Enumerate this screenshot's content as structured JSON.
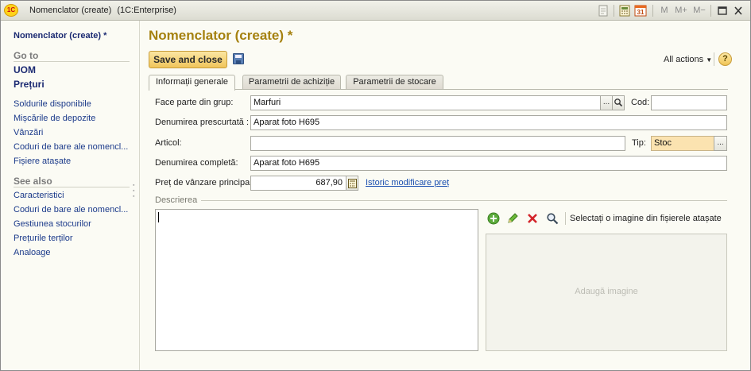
{
  "window": {
    "title": "Nomenclator (create)",
    "app_name": "(1C:Enterprise)",
    "logo_text": "1С",
    "calendar_day": "31",
    "memory_buttons": [
      "M",
      "M+",
      "M−"
    ]
  },
  "left_panel": {
    "title": "Nomenclator (create) *",
    "goto_section": "Go to",
    "goto_bold_links": [
      "UOM",
      "Prețuri"
    ],
    "goto_links": [
      "Soldurile disponibile",
      "Mișcările de depozite",
      "Vânzări",
      "Coduri de bare ale nomencl...",
      "Fișiere atașate"
    ],
    "see_also_section": "See also",
    "see_also_links": [
      "Caracteristici",
      "Coduri de bare ale nomencl...",
      "Gestiunea stocurilor",
      "Prețurile terților",
      "Analoage"
    ]
  },
  "form": {
    "title": "Nomenclator (create) *",
    "save_close": "Save and close",
    "all_actions": "All actions",
    "help": "?",
    "tabs": [
      "Informații generale",
      "Parametrii de achiziție",
      "Parametrii de stocare"
    ],
    "fields": {
      "group_label": "Face parte din grup:",
      "group_value": "Marfuri",
      "cod_label": "Cod:",
      "cod_value": "",
      "short_name_label": "Denumirea prescurtată :",
      "short_name_value": "Aparat foto H695",
      "article_label": "Articol:",
      "article_value": "",
      "type_label": "Tip:",
      "type_value": "Stoc",
      "full_name_label": "Denumirea completă:",
      "full_name_value": "Aparat foto H695",
      "price_label": "Preț de vânzare principal:",
      "price_value": "687,90",
      "price_history_link": "Istoric modificare preț"
    },
    "description_label": "Descrierea",
    "description_value": "",
    "image_select_label": "Selectați o imagine din fișierele atașate",
    "image_placeholder": "Adaugă imagine"
  },
  "colors": {
    "form_title": "#a5810f",
    "nav_link": "#1b3a8a",
    "save_button": "#f0c55b",
    "type_field": "#fbe3b0"
  }
}
